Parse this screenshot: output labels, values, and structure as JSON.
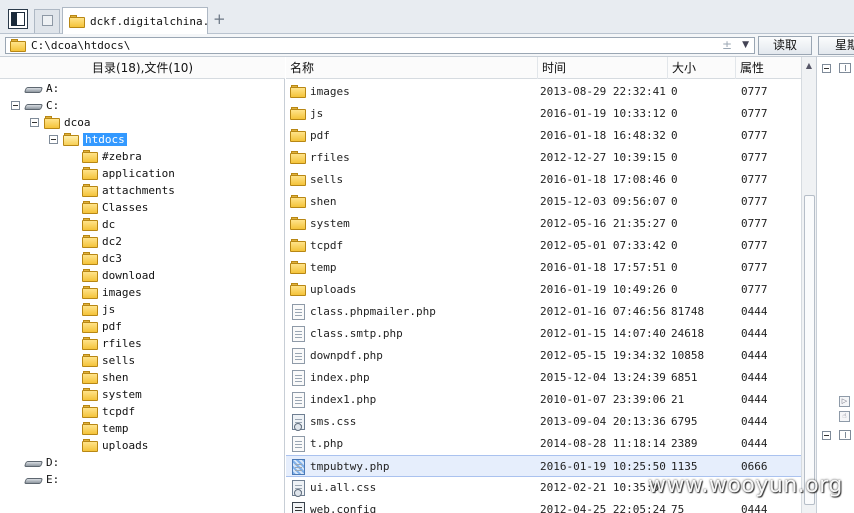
{
  "tab": {
    "title": "dckf.digitalchina..."
  },
  "address": {
    "path": "C:\\dcoa\\htdocs\\"
  },
  "buttons": {
    "read": "读取",
    "week": "星期"
  },
  "tree": {
    "header": "目录(18),文件(10)",
    "drives": [
      {
        "label": "A:"
      },
      {
        "label": "C:"
      },
      {
        "label": "D:"
      },
      {
        "label": "E:"
      }
    ],
    "dcoa": "dcoa",
    "htdocs": "htdocs",
    "children": [
      "#zebra",
      "application",
      "attachments",
      "Classes",
      "dc",
      "dc2",
      "dc3",
      "download",
      "images",
      "js",
      "pdf",
      "rfiles",
      "sells",
      "shen",
      "system",
      "tcpdf",
      "temp",
      "uploads"
    ]
  },
  "list": {
    "columns": [
      "名称",
      "时间",
      "大小",
      "属性"
    ],
    "rows": [
      {
        "name": "images",
        "time": "2013-08-29 22:32:41",
        "size": "0",
        "attr": "0777",
        "type": "folder"
      },
      {
        "name": "js",
        "time": "2016-01-19 10:33:12",
        "size": "0",
        "attr": "0777",
        "type": "folder"
      },
      {
        "name": "pdf",
        "time": "2016-01-18 16:48:32",
        "size": "0",
        "attr": "0777",
        "type": "folder"
      },
      {
        "name": "rfiles",
        "time": "2012-12-27 10:39:15",
        "size": "0",
        "attr": "0777",
        "type": "folder"
      },
      {
        "name": "sells",
        "time": "2016-01-18 17:08:46",
        "size": "0",
        "attr": "0777",
        "type": "folder"
      },
      {
        "name": "shen",
        "time": "2015-12-03 09:56:07",
        "size": "0",
        "attr": "0777",
        "type": "folder"
      },
      {
        "name": "system",
        "time": "2012-05-16 21:35:27",
        "size": "0",
        "attr": "0777",
        "type": "folder"
      },
      {
        "name": "tcpdf",
        "time": "2012-05-01 07:33:42",
        "size": "0",
        "attr": "0777",
        "type": "folder"
      },
      {
        "name": "temp",
        "time": "2016-01-18 17:57:51",
        "size": "0",
        "attr": "0777",
        "type": "folder"
      },
      {
        "name": "uploads",
        "time": "2016-01-19 10:49:26",
        "size": "0",
        "attr": "0777",
        "type": "folder"
      },
      {
        "name": "class.phpmailer.php",
        "time": "2012-01-16 07:46:56",
        "size": "81748",
        "attr": "0444",
        "type": "file"
      },
      {
        "name": "class.smtp.php",
        "time": "2012-01-15 14:07:40",
        "size": "24618",
        "attr": "0444",
        "type": "file"
      },
      {
        "name": "downpdf.php",
        "time": "2012-05-15 19:34:32",
        "size": "10858",
        "attr": "0444",
        "type": "file"
      },
      {
        "name": "index.php",
        "time": "2015-12-04 13:24:39",
        "size": "6851",
        "attr": "0444",
        "type": "file"
      },
      {
        "name": "index1.php",
        "time": "2010-01-07 23:39:06",
        "size": "21",
        "attr": "0444",
        "type": "file"
      },
      {
        "name": "sms.css",
        "time": "2013-09-04 20:13:36",
        "size": "6795",
        "attr": "0444",
        "type": "css"
      },
      {
        "name": "t.php",
        "time": "2014-08-28 11:18:14",
        "size": "2389",
        "attr": "0444",
        "type": "file"
      },
      {
        "name": "tmpubtwy.php",
        "time": "2016-01-19 10:25:50",
        "size": "1135",
        "attr": "0666",
        "type": "selected"
      },
      {
        "name": "ui.all.css",
        "time": "2012-02-21 10:35:0",
        "size": "",
        "attr": "",
        "type": "css"
      },
      {
        "name": "web.config",
        "time": "2012-04-25 22:05:24",
        "size": "75",
        "attr": "0444",
        "type": "config"
      }
    ]
  },
  "watermark": "www.wooyun.org",
  "colors": {
    "selection": "#3399ff",
    "folder": "#f4c33a"
  }
}
